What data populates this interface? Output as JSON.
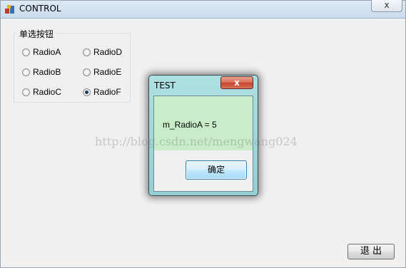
{
  "window": {
    "title": "CONTROL",
    "close_label": "x"
  },
  "group": {
    "label": "单选按钮",
    "radios": [
      {
        "label": "RadioA",
        "checked": false
      },
      {
        "label": "RadioB",
        "checked": false
      },
      {
        "label": "RadioC",
        "checked": false
      },
      {
        "label": "RadioD",
        "checked": false
      },
      {
        "label": "RadioE",
        "checked": false
      },
      {
        "label": "RadioF",
        "checked": true
      }
    ]
  },
  "exit_button": {
    "label": "退 出"
  },
  "watermark": "http://blog.csdn.net/mengwang024",
  "dialog": {
    "title": "TEST",
    "close_label": "x",
    "message": "m_RadioA = 5",
    "ok_label": "确定"
  }
}
